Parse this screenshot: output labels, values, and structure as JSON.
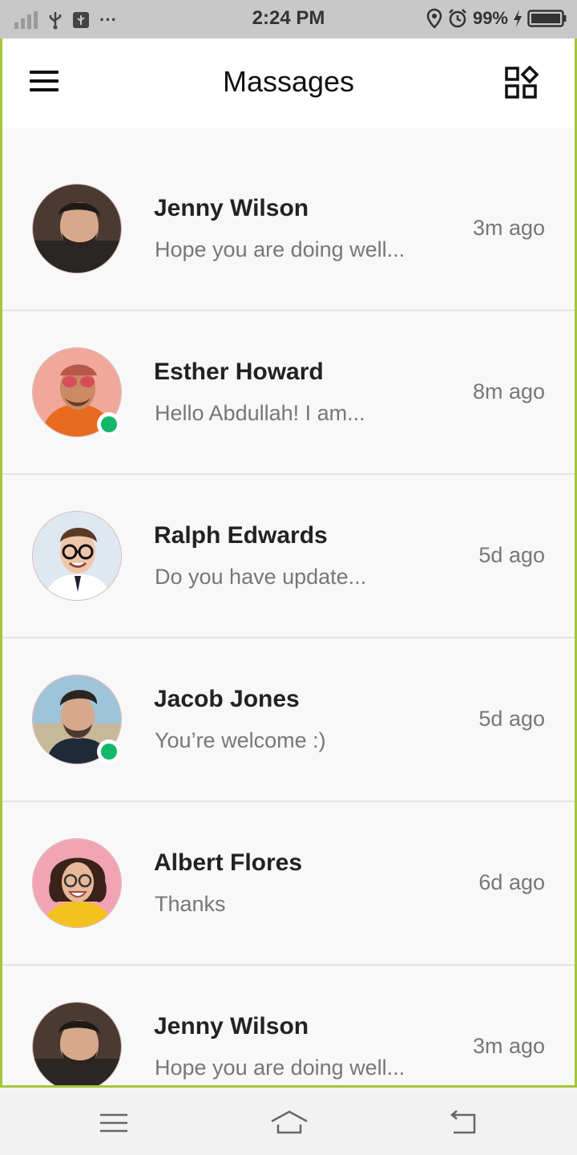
{
  "status_bar": {
    "time": "2:24 PM",
    "battery": "99%",
    "more": "···"
  },
  "app_bar": {
    "title": "Massages",
    "menu_icon": "hamburger-menu-icon",
    "grid_icon": "grid-apps-icon"
  },
  "conversations": [
    {
      "name": "Jenny Wilson",
      "message": "Hope you are doing well...",
      "time": "3m ago",
      "online": false
    },
    {
      "name": "Esther Howard",
      "message": "Hello Abdullah! I am...",
      "time": "8m ago",
      "online": true
    },
    {
      "name": "Ralph Edwards",
      "message": "Do you have update...",
      "time": "5d ago",
      "online": false
    },
    {
      "name": "Jacob Jones",
      "message": "You’re welcome :)",
      "time": "5d ago",
      "online": true
    },
    {
      "name": "Albert Flores",
      "message": "Thanks",
      "time": "6d ago",
      "online": false
    },
    {
      "name": "Jenny Wilson",
      "message": "Hope you are doing well...",
      "time": "3m ago",
      "online": false
    }
  ],
  "colors": {
    "online_dot": "#12b76a",
    "frame_border": "#a4c639",
    "status_bar_bg": "#c8c8c8"
  }
}
